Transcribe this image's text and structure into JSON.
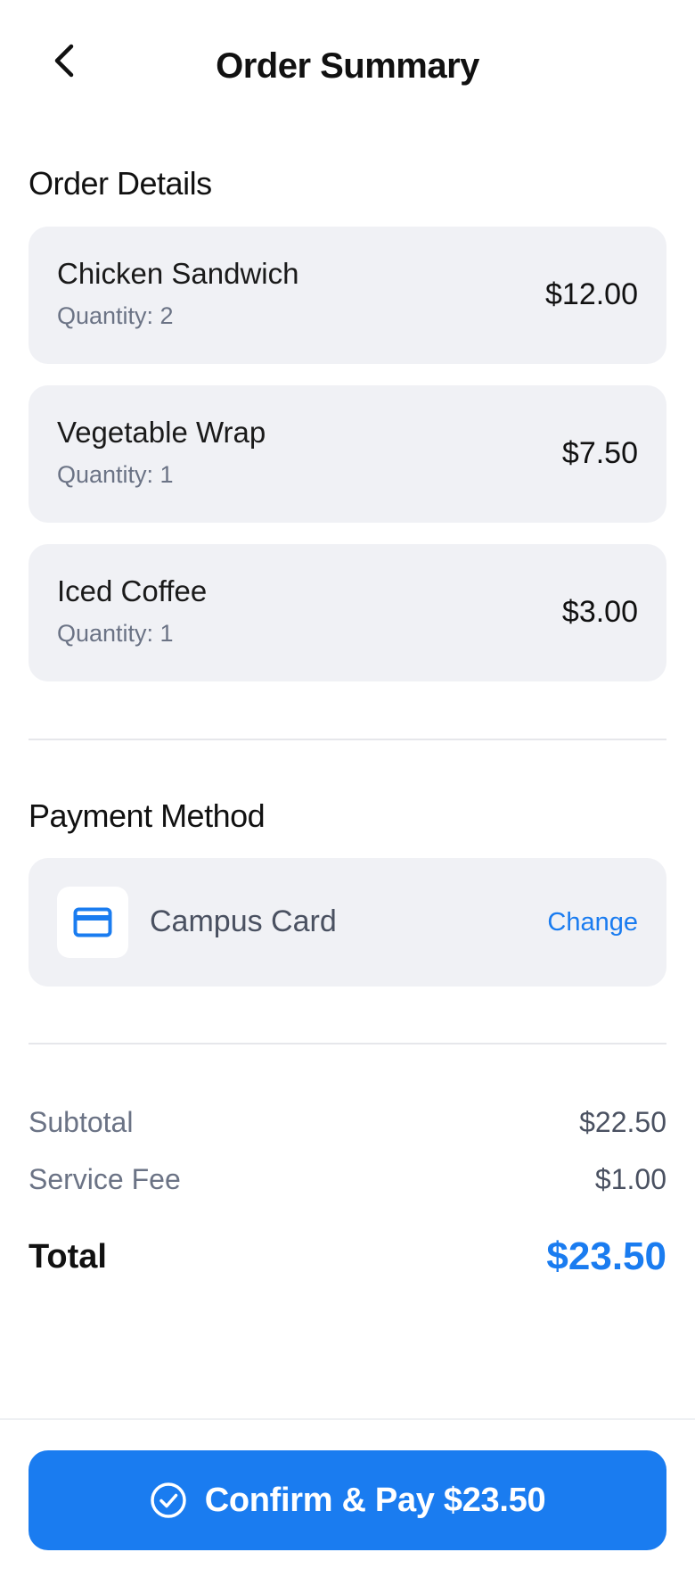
{
  "header": {
    "title": "Order Summary",
    "back_icon": "chevron-left-icon"
  },
  "order_details": {
    "title": "Order Details",
    "items": [
      {
        "name": "Chicken Sandwich",
        "quantity": "Quantity: 2",
        "price": "$12.00"
      },
      {
        "name": "Vegetable Wrap",
        "quantity": "Quantity: 1",
        "price": "$7.50"
      },
      {
        "name": "Iced Coffee",
        "quantity": "Quantity: 1",
        "price": "$3.00"
      }
    ]
  },
  "payment": {
    "title": "Payment Method",
    "method": "Campus Card",
    "icon": "credit-card-icon",
    "change_label": "Change"
  },
  "summary": {
    "subtotal_label": "Subtotal",
    "subtotal_value": "$22.50",
    "fee_label": "Service Fee",
    "fee_value": "$1.00",
    "total_label": "Total",
    "total_value": "$23.50"
  },
  "confirm": {
    "label": "Confirm & Pay $23.50",
    "icon": "check-circle-icon"
  },
  "colors": {
    "accent": "#1a7cf0",
    "card_bg": "#f0f1f5",
    "muted_text": "#6b7385"
  }
}
